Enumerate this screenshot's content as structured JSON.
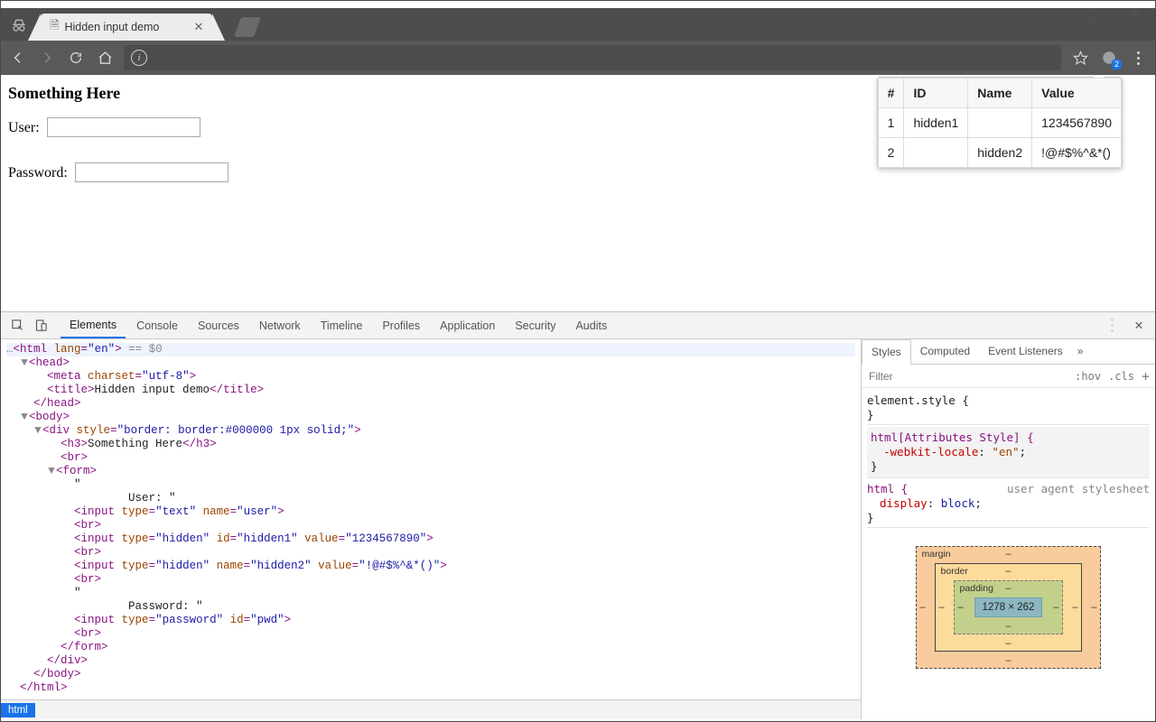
{
  "window": {
    "tab_title": "Hidden input demo",
    "extension_badge": "2"
  },
  "toolbar": {
    "nav": {
      "back": "←",
      "forward": "→",
      "reload": "↻",
      "home": "⌂"
    }
  },
  "page": {
    "heading": "Something Here",
    "user_label": "User:",
    "password_label": "Password:"
  },
  "popup": {
    "headers": {
      "num": "#",
      "id": "ID",
      "name": "Name",
      "value": "Value"
    },
    "rows": [
      {
        "num": "1",
        "id": "hidden1",
        "name": "",
        "value": "1234567890"
      },
      {
        "num": "2",
        "id": "",
        "name": "hidden2",
        "value": "!@#$%^&*()"
      }
    ]
  },
  "devtools": {
    "tabs": [
      "Elements",
      "Console",
      "Sources",
      "Network",
      "Timeline",
      "Profiles",
      "Application",
      "Security",
      "Audits"
    ],
    "active_tab": "Elements",
    "selected_annot": " == $0",
    "dom": {
      "html_open": "<html ",
      "lang_attr": "lang",
      "lang_val": "\"en\"",
      "html_close_gt": ">",
      "head": "<head>",
      "meta": "<meta ",
      "charset_attr": "charset",
      "charset_val": "\"utf-8\"",
      "gt": ">",
      "title_open": "<title>",
      "title_text": "Hidden input demo",
      "title_close": "</title>",
      "head_close": "</head>",
      "body": "<body>",
      "div_open": "<div ",
      "style_attr": "style",
      "style_val": "\"border: border:#000000 1px solid;\"",
      "h3_open": "<h3>",
      "h3_text": "Something Here",
      "h3_close": "</h3>",
      "br": "<br>",
      "form": "<form>",
      "quote": "\"",
      "user_text": "                  User: ",
      "input_open": "<input ",
      "type_attr": "type",
      "type_text": "\"text\"",
      "name_attr": "name",
      "name_user": "\"user\"",
      "type_hidden": "\"hidden\"",
      "id_attr": "id",
      "id_h1": "\"hidden1\"",
      "value_attr": "value",
      "value_h1": "\"1234567890\"",
      "name_h2": "\"hidden2\"",
      "value_h2": "\"!@#$%^&*()\"",
      "pwd_text": "                  Password: ",
      "type_pwd": "\"password\"",
      "id_pwd": "\"pwd\"",
      "form_close": "</form>",
      "div_close": "</div>",
      "body_close": "</body>",
      "html_close": "</html>"
    },
    "breadcrumb": "html",
    "styles": {
      "tabs": [
        "Styles",
        "Computed",
        "Event Listeners"
      ],
      "filter_placeholder": "Filter",
      "hov": ":hov",
      "cls": ".cls",
      "rule_element": "element.style {",
      "rule_element_close": "}",
      "rule_attr_sel": "html[Attributes Style] {",
      "rule_attr_prop": "-webkit-locale",
      "rule_attr_val": "\"en\"",
      "rule_html_sel": "html {",
      "rule_html_src": "user agent stylesheet",
      "rule_html_prop": "display",
      "rule_html_val": "block",
      "close_brace": "}",
      "semicolon": ";",
      "colon": ": "
    },
    "boxmodel": {
      "margin": "margin",
      "border": "border",
      "padding": "padding",
      "content": "1278 × 262",
      "dash": "–"
    }
  }
}
